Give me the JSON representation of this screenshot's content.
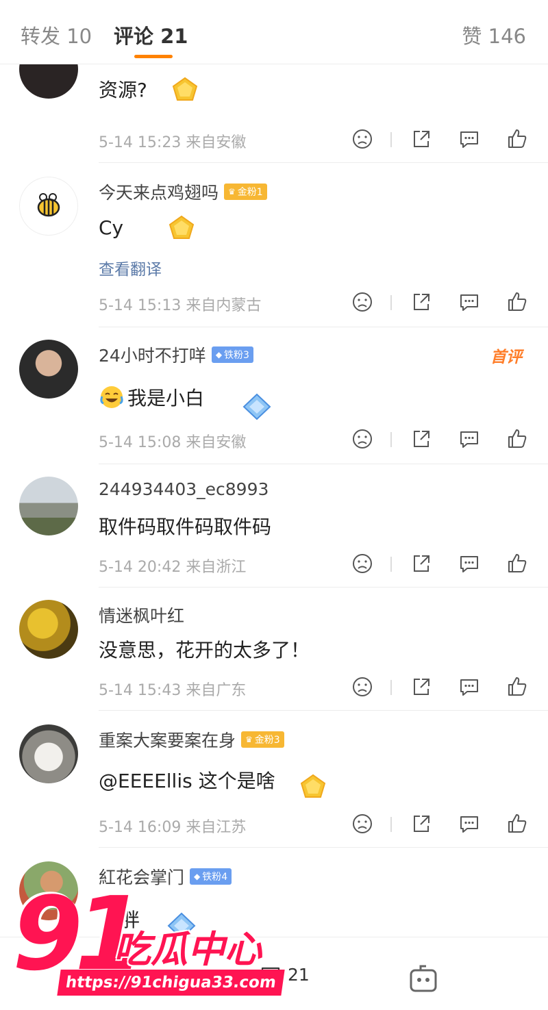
{
  "tabs": {
    "repost": "转发 10",
    "comment": "评论 21",
    "like": "赞 146"
  },
  "colors": {
    "accent": "#ff8200",
    "link": "#5b7aa8",
    "watermark": "#ff1452"
  },
  "comments": [
    {
      "username": "",
      "badge": "",
      "text": "资源?",
      "translate": "",
      "meta": "5-14 15:23 来自安徽",
      "hot": ""
    },
    {
      "username": "今天来点鸡翅吗",
      "badge": "金粉1",
      "text": "Cy",
      "translate": "查看翻译",
      "meta": "5-14 15:13 来自内蒙古",
      "hot": ""
    },
    {
      "username": "24小时不打咩",
      "badge": "铁粉3",
      "text": "我是小白",
      "translate": "",
      "meta": "5-14 15:08 来自安徽",
      "hot": "首评"
    },
    {
      "username": "244934403_ec8993",
      "badge": "",
      "text": "取件码取件码取件码",
      "translate": "",
      "meta": "5-14 20:42 来自浙江",
      "hot": ""
    },
    {
      "username": "情迷枫叶红",
      "badge": "",
      "text": "没意思，花开的太多了！",
      "translate": "",
      "meta": "5-14 15:43 来自广东",
      "hot": ""
    },
    {
      "username": "重案大案要案在身",
      "badge": "金粉3",
      "text": "@EEEEllis  这个是啥",
      "translate": "",
      "meta": "5-14 16:09 来自江苏",
      "hot": ""
    },
    {
      "username": "紅花会掌门",
      "badge": "铁粉4",
      "text": "胖",
      "translate": "",
      "meta": "",
      "hot": ""
    }
  ],
  "bottom": {
    "reply_count": "21"
  },
  "watermark": {
    "number": "91",
    "name": "吃瓜中心",
    "url": "https://91chigua33.com"
  },
  "icons": [
    "dislike-icon",
    "share-icon",
    "reply-icon",
    "like-icon",
    "laugh-cry-emoji",
    "gem-icon"
  ]
}
